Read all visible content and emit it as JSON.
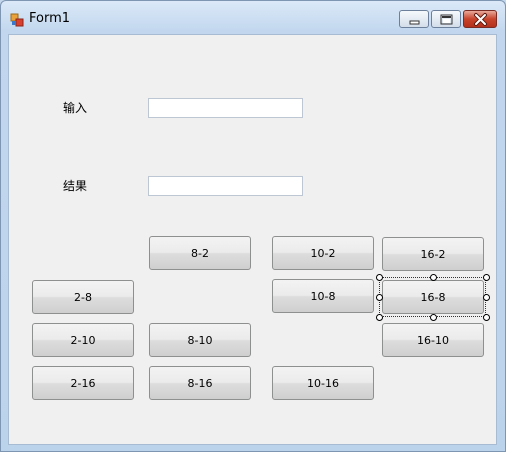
{
  "window": {
    "title": "Form1"
  },
  "labels": {
    "input": "输入",
    "result": "结果"
  },
  "fields": {
    "input_value": "",
    "result_value": ""
  },
  "buttons": {
    "b8_2": "8-2",
    "b10_2": "10-2",
    "b16_2": "16-2",
    "b2_8": "2-8",
    "b10_8": "10-8",
    "b16_8": "16-8",
    "b2_10": "2-10",
    "b8_10": "8-10",
    "b16_10": "16-10",
    "b2_16": "2-16",
    "b8_16": "8-16",
    "b10_16": "10-16"
  },
  "icons": {
    "app": "form-app-icon",
    "minimize": "minimize-icon",
    "maximize": "maximize-icon",
    "close": "close-icon"
  }
}
